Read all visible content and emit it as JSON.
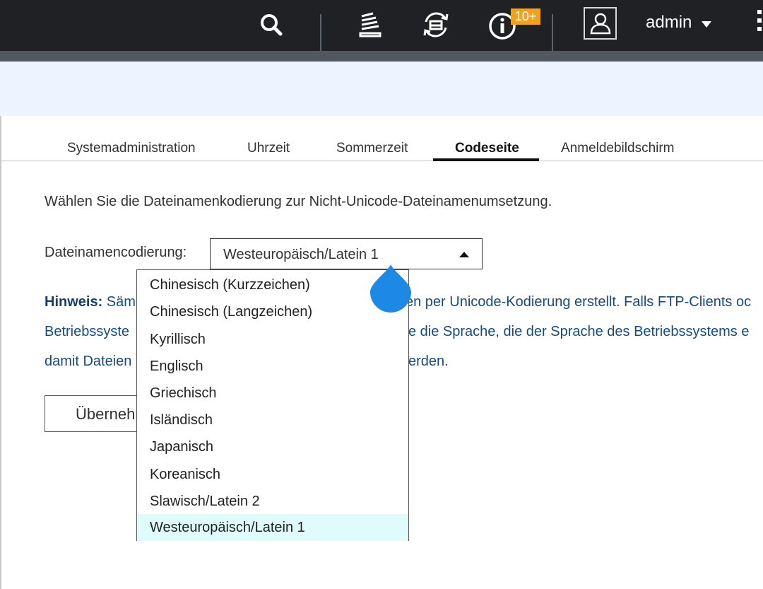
{
  "topbar": {
    "badge_count": "10+",
    "user_name": "admin",
    "icons": [
      "search-icon",
      "stack-icon",
      "sync-icon",
      "info-icon",
      "user-icon",
      "more-icon"
    ]
  },
  "tabs": [
    {
      "label": "Systemadministration",
      "active": false
    },
    {
      "label": "Uhrzeit",
      "active": false
    },
    {
      "label": "Sommerzeit",
      "active": false
    },
    {
      "label": "Codeseite",
      "active": true
    },
    {
      "label": "Anmeldebildschirm",
      "active": false
    }
  ],
  "main": {
    "intro": "Wählen Sie die Dateinamenkodierung zur Nicht-Unicode-Dateinamenumsetzung.",
    "encoding_label": "Dateinamencodierung:",
    "encoding_value": "Westeuropäisch/Latein 1",
    "hint_label": "Hinweis:",
    "hint_line1_start": " Säm",
    "hint_line1_end": "en per Unicode-Kodierung erstellt. Falls FTP-Clients oc",
    "hint_line2_start": "Betriebssyste",
    "hint_line2_end": "e die Sprache, die der Sprache des Betriebssystems e",
    "hint_line3_start": "damit Dateien",
    "hint_line3_end": "erden.",
    "apply_label": "Übernehmen"
  },
  "dropdown": {
    "options": [
      "Chinesisch (Kurzzeichen)",
      "Chinesisch (Langzeichen)",
      "Kyrillisch",
      "Englisch",
      "Griechisch",
      "Isländisch",
      "Japanisch",
      "Koreanisch",
      "Slawisch/Latein 2",
      "Westeuropäisch/Latein 1"
    ],
    "selected": "Westeuropäisch/Latein 1"
  },
  "colors": {
    "topbar": "#1f2124",
    "badge": "#f0a21e",
    "band": "#eef4ff",
    "hint_text": "#1a4a79",
    "selected_option": "#dffbfb",
    "touch_cursor": "#1e88e5"
  }
}
